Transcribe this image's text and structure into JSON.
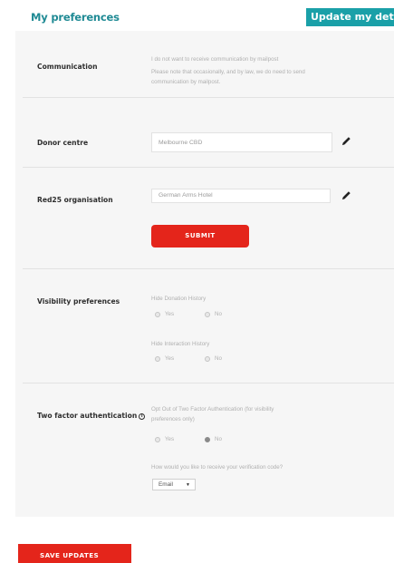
{
  "header": {
    "title": "My preferences",
    "update_button": "Update my details"
  },
  "communication": {
    "label": "Communication",
    "option_text": "I do not want to receive communication by mailpost",
    "note_line1": "Please note that occasionally, and by law, we do need to send",
    "note_line2": "communication by mailpost."
  },
  "donor_centre": {
    "label": "Donor centre",
    "value": "Melbourne CBD"
  },
  "red25": {
    "label": "Red25 organisation",
    "value": "German Arms Hotel"
  },
  "submit_button": "SUBMIT",
  "visibility": {
    "label": "Visibility preferences",
    "donation_history": {
      "title": "Hide Donation History",
      "yes": "Yes",
      "no": "No",
      "selected": null
    },
    "interaction_history": {
      "title": "Hide Interaction History",
      "yes": "Yes",
      "no": "No",
      "selected": null
    }
  },
  "two_factor": {
    "label": "Two factor authentication",
    "opt_out_line1": "Opt Out of Two Factor Authentication (for visibility",
    "opt_out_line2": "preferences only)",
    "yes": "Yes",
    "no": "No",
    "selected": "No",
    "code_question": "How would you like to receive your verification code?",
    "code_method": "Email"
  },
  "save_button": "SAVE UPDATES",
  "icons": {
    "edit": "pencil-icon",
    "info": "info-icon",
    "dropdown": "chevron-down-icon"
  },
  "colors": {
    "accent_teal": "#1aa0a8",
    "button_red": "#e4251b"
  }
}
